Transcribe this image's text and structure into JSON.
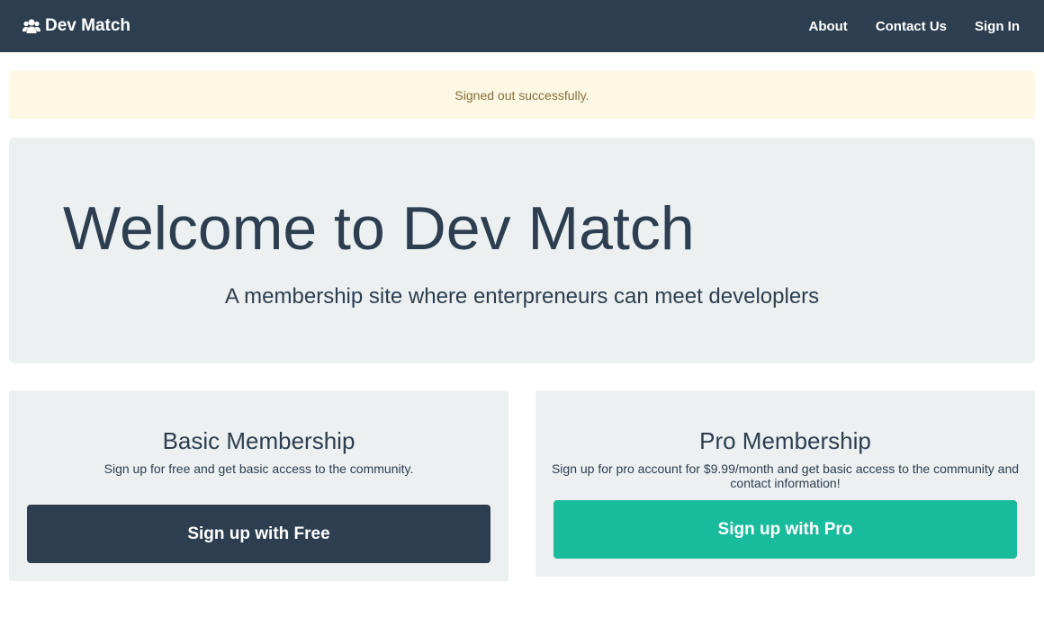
{
  "navbar": {
    "brand": "Dev Match",
    "brand_icon": "users-icon",
    "links": [
      {
        "label": "About"
      },
      {
        "label": "Contact Us"
      },
      {
        "label": "Sign In"
      }
    ]
  },
  "alert": {
    "message": "Signed out successfully."
  },
  "hero": {
    "title": "Welcome to Dev Match",
    "subtitle": "A membership site where enterpreneurs can meet developlers"
  },
  "plans": {
    "basic": {
      "title": "Basic Membership",
      "description": "Sign up for free and get basic access to the community.",
      "button": "Sign up with Free"
    },
    "pro": {
      "title": "Pro Membership",
      "description": "Sign up for pro account for $9.99/month and get basic access to the community and contact information!",
      "button": "Sign up with Pro"
    }
  },
  "colors": {
    "primary": "#2c3e50",
    "success": "#18bc9c",
    "warning_bg": "#fcf8e3",
    "warning_text": "#8a6d3b",
    "panel_bg": "#ecf0f1"
  }
}
